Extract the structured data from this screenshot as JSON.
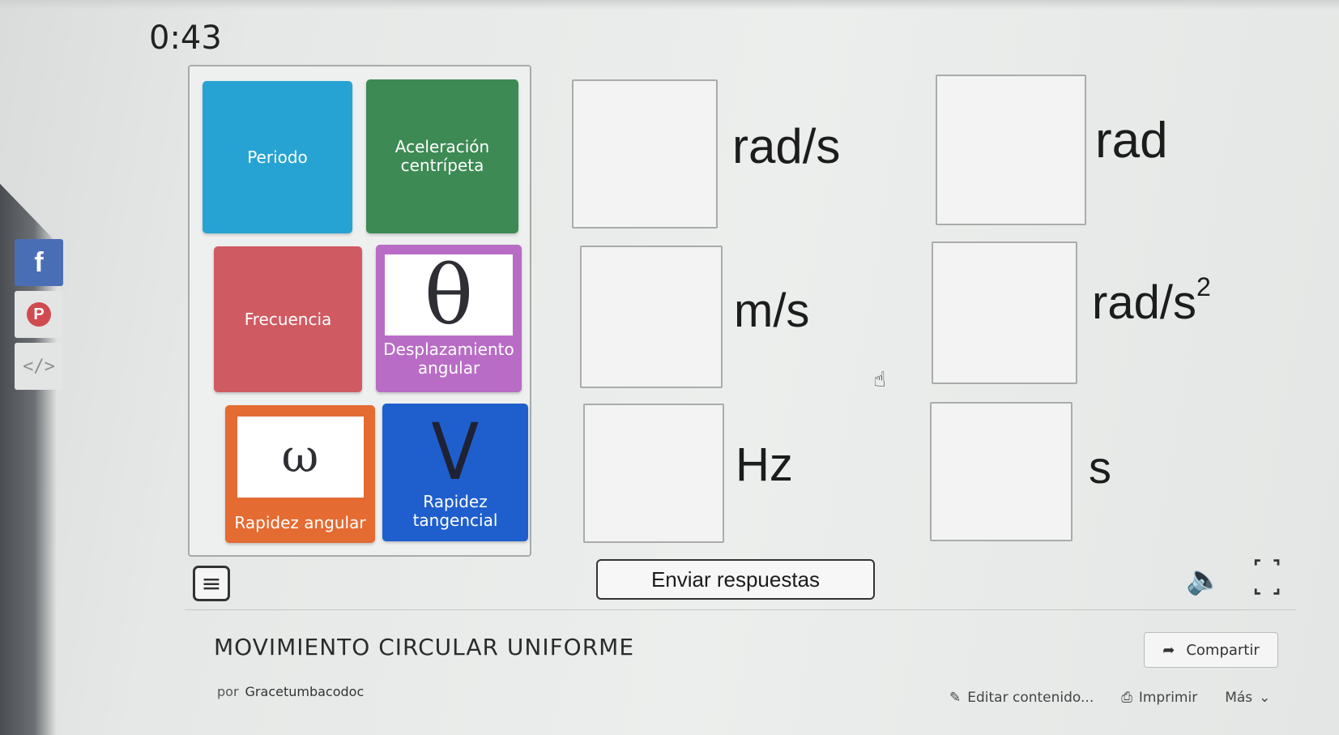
{
  "timer": "0:43",
  "social": {
    "facebook": "f",
    "pinterest": "P",
    "embed": "</>"
  },
  "cards": [
    {
      "label": "Periodo",
      "color": "#27a3d3"
    },
    {
      "label": "Aceleración centrípeta",
      "color": "#3d8a55"
    },
    {
      "label": "Frecuencia",
      "color": "#d05a62"
    },
    {
      "label": "Desplazamiento angular",
      "symbol": "θ",
      "color": "#b86cc5"
    },
    {
      "label": "Rapidez angular",
      "symbol": "ω",
      "color": "#e46b32"
    },
    {
      "label": "Rapidez tangencial",
      "symbol": "V",
      "color": "#1f5fcd"
    }
  ],
  "targets": [
    {
      "unit": "rad/s"
    },
    {
      "unit": "rad"
    },
    {
      "unit": "m/s"
    },
    {
      "unit_base": "rad/s",
      "unit_exp": "2"
    },
    {
      "unit": "Hz"
    },
    {
      "unit": "s"
    }
  ],
  "controls": {
    "submit_label": "Enviar respuestas"
  },
  "activity": {
    "title": "MOVIMIENTO CIRCULAR UNIFORME",
    "author_prefix": "por",
    "author": "Gracetumbacodoc",
    "share_label": "Compartir",
    "edit_label": "Editar contenido...",
    "print_label": "Imprimir",
    "more_label": "Más"
  }
}
